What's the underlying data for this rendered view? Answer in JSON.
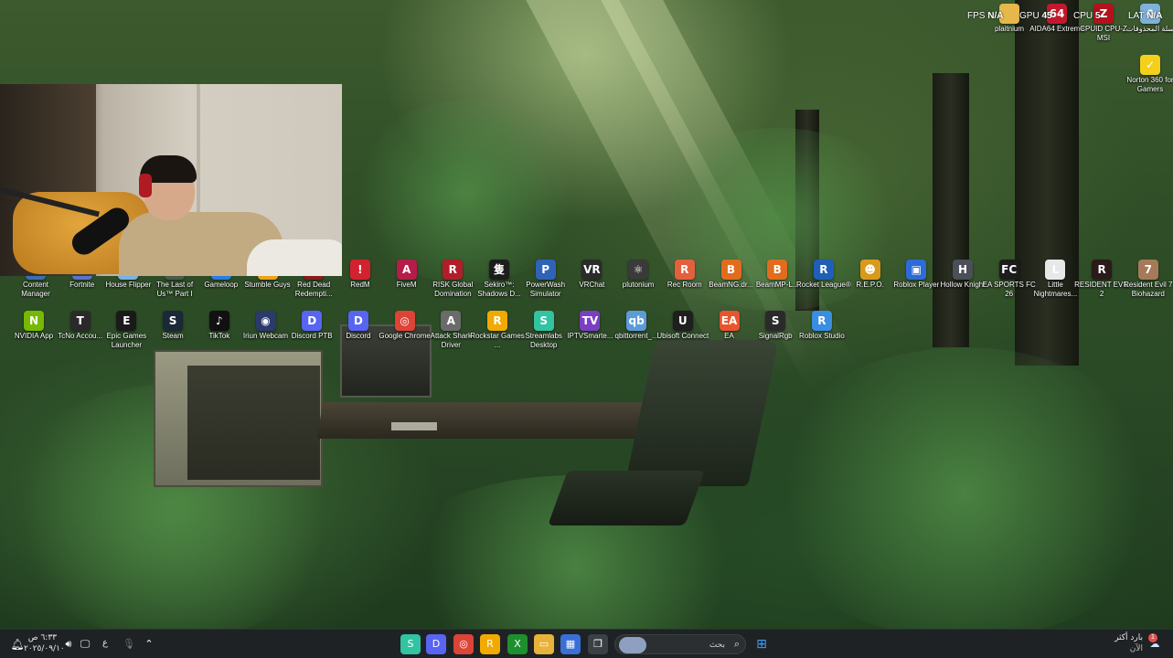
{
  "desktop": {
    "icons_row_top": [
      {
        "label": "plaitnium",
        "icon": "folder-icon",
        "color": "#e6b74a",
        "glyph": ""
      },
      {
        "label": "AIDA64 Extreme",
        "icon": "aida64-icon",
        "color": "#c0192b",
        "glyph": "64"
      },
      {
        "label": "CPUID CPU-Z MSI",
        "icon": "cpuz-icon",
        "color": "#b3121d",
        "glyph": "Z"
      },
      {
        "label": "سلة المحذوفات",
        "icon": "recycle-bin-icon",
        "color": "#7fb2d9",
        "glyph": "♻"
      },
      {
        "label": "Norton 360 for Gamers",
        "icon": "norton-icon",
        "color": "#f4d01c",
        "glyph": "✓"
      }
    ],
    "icons_row_1": [
      {
        "label": "Content Manager",
        "icon": "content-manager-icon",
        "color": "#3a6fb0",
        "glyph": "C"
      },
      {
        "label": "Fortnite",
        "icon": "fortnite-icon",
        "color": "#5a74c8",
        "glyph": "F"
      },
      {
        "label": "House Flipper",
        "icon": "house-flipper-icon",
        "color": "#7bb1e0",
        "glyph": "H"
      },
      {
        "label": "The Last of Us™ Part I",
        "icon": "last-of-us-icon",
        "color": "#4b5a48",
        "glyph": "T"
      },
      {
        "label": "Gameloop",
        "icon": "gameloop-icon",
        "color": "#2a7de1",
        "glyph": "G"
      },
      {
        "label": "Stumble Guys",
        "icon": "stumble-guys-icon",
        "color": "#f0a21e",
        "glyph": "S"
      },
      {
        "label": "Red Dead Redempti...",
        "icon": "red-dead-icon",
        "color": "#8b1a1a",
        "glyph": "R"
      },
      {
        "label": "RedM",
        "icon": "redm-icon",
        "color": "#d3222e",
        "glyph": "!"
      },
      {
        "label": "FiveM",
        "icon": "fivem-icon",
        "color": "#b51c4a",
        "glyph": "A"
      },
      {
        "label": "RISK Global Domination",
        "icon": "risk-icon",
        "color": "#b01e2a",
        "glyph": "R"
      },
      {
        "label": "Sekiro™: Shadows D...",
        "icon": "sekiro-icon",
        "color": "#1d1d1d",
        "glyph": "隻"
      },
      {
        "label": "PowerWash Simulator",
        "icon": "powerwash-icon",
        "color": "#2f63b8",
        "glyph": "P"
      },
      {
        "label": "VRChat",
        "icon": "vrchat-icon",
        "color": "#2b2b2b",
        "glyph": "VR"
      },
      {
        "label": "plutonium",
        "icon": "plutonium-icon",
        "color": "#3a3a3a",
        "glyph": "⚛"
      },
      {
        "label": "Rec Room",
        "icon": "rec-room-icon",
        "color": "#e3603c",
        "glyph": "R"
      },
      {
        "label": "BeamNG.dr...",
        "icon": "beamng-icon",
        "color": "#e26c1e",
        "glyph": "B"
      },
      {
        "label": "BeamMP-L...",
        "icon": "beammp-icon",
        "color": "#e26c1e",
        "glyph": "B"
      },
      {
        "label": "Rocket League®",
        "icon": "rocket-league-icon",
        "color": "#1f5fb8",
        "glyph": "R"
      },
      {
        "label": "R.E.P.O.",
        "icon": "repo-icon",
        "color": "#d99a1c",
        "glyph": "☻"
      },
      {
        "label": "Roblox Player",
        "icon": "roblox-icon",
        "color": "#2c6bd8",
        "glyph": "▣"
      },
      {
        "label": "Hollow Knight",
        "icon": "hollow-knight-icon",
        "color": "#4a4f58",
        "glyph": "H"
      },
      {
        "label": "EA SPORTS FC 26",
        "icon": "ea-fc-icon",
        "color": "#1c1c1c",
        "glyph": "FC"
      },
      {
        "label": "Little Nightmares...",
        "icon": "little-nightmares-icon",
        "color": "#e8e8e8",
        "glyph": "L"
      },
      {
        "label": "RESIDENT EVIL 2",
        "icon": "resident-evil-2-icon",
        "color": "#2b1a1a",
        "glyph": "R"
      },
      {
        "label": "Resident Evil 7 Biohazard",
        "icon": "resident-evil-7-icon",
        "color": "#a57a5a",
        "glyph": "7"
      }
    ],
    "icons_row_2": [
      {
        "label": "NVIDIA App",
        "icon": "nvidia-icon",
        "color": "#76b900",
        "glyph": "N"
      },
      {
        "label": "TcNo Accou...",
        "icon": "tcno-icon",
        "color": "#2a2a2a",
        "glyph": "T"
      },
      {
        "label": "Epic Games Launcher",
        "icon": "epic-games-icon",
        "color": "#1a1a1a",
        "glyph": "E"
      },
      {
        "label": "Steam",
        "icon": "steam-icon",
        "color": "#1b2838",
        "glyph": "S"
      },
      {
        "label": "TikTok",
        "icon": "tiktok-icon",
        "color": "#111111",
        "glyph": "♪"
      },
      {
        "label": "Iriun Webcam",
        "icon": "iriun-icon",
        "color": "#2a3a6a",
        "glyph": "◉"
      },
      {
        "label": "Discord PTB",
        "icon": "discord-ptb-icon",
        "color": "#5865f2",
        "glyph": "D"
      },
      {
        "label": "Discord",
        "icon": "discord-icon",
        "color": "#5865f2",
        "glyph": "D"
      },
      {
        "label": "Google Chrome",
        "icon": "chrome-icon",
        "color": "#db4437",
        "glyph": "◎"
      },
      {
        "label": "Attack Shark Driver",
        "icon": "attack-shark-icon",
        "color": "#6b6b6b",
        "glyph": "A"
      },
      {
        "label": "Rockstar Games ...",
        "icon": "rockstar-icon",
        "color": "#f2a900",
        "glyph": "R"
      },
      {
        "label": "Streamlabs Desktop",
        "icon": "streamlabs-icon",
        "color": "#31c3a2",
        "glyph": "S"
      },
      {
        "label": "IPTVSmarte...",
        "icon": "iptv-icon",
        "color": "#7b3fc4",
        "glyph": "TV"
      },
      {
        "label": "qbittorrent_...",
        "icon": "qbittorrent-icon",
        "color": "#5d9bd6",
        "glyph": "qb"
      },
      {
        "label": "Ubisoft Connect",
        "icon": "ubisoft-icon",
        "color": "#1f1f1f",
        "glyph": "U"
      },
      {
        "label": "EA",
        "icon": "ea-icon",
        "color": "#e8542c",
        "glyph": "EA"
      },
      {
        "label": "SignalRgb",
        "icon": "signalrgb-icon",
        "color": "#2a2a2a",
        "glyph": "S"
      },
      {
        "label": "Roblox Studio",
        "icon": "roblox-studio-icon",
        "color": "#3a8de0",
        "glyph": "R"
      }
    ]
  },
  "osd": {
    "fps_label": "FPS",
    "fps_value": "N/A",
    "gpu_label": "GPU",
    "gpu_value": "45",
    "cpu_label": "CPU",
    "cpu_value": "5",
    "lat_label": "LAT",
    "lat_value": "N/A"
  },
  "taskbar": {
    "time": "٦:٣٣ ص",
    "date": "٢٠٢٥/٠٩/١٠",
    "lang": "ع",
    "search_placeholder": "بحث",
    "weather_line1": "بارد أكثر",
    "weather_line2": "الآن",
    "weather_badge": "1",
    "apps": [
      {
        "name": "streamlabs-taskbar-icon",
        "color": "#31c3a2",
        "glyph": "S"
      },
      {
        "name": "discord-taskbar-icon",
        "color": "#5865f2",
        "glyph": "D"
      },
      {
        "name": "chrome-taskbar-icon",
        "color": "#db4437",
        "glyph": "◎"
      },
      {
        "name": "rockstar-taskbar-icon",
        "color": "#f2a900",
        "glyph": "R"
      },
      {
        "name": "xbox-taskbar-icon",
        "color": "#1e8f2e",
        "glyph": "X"
      },
      {
        "name": "file-explorer-taskbar-icon",
        "color": "#e8b33a",
        "glyph": "▭"
      },
      {
        "name": "store-taskbar-icon",
        "color": "#3a6fd8",
        "glyph": "▦"
      },
      {
        "name": "task-view-taskbar-icon",
        "color": "#3b4044",
        "glyph": "❐"
      }
    ]
  }
}
